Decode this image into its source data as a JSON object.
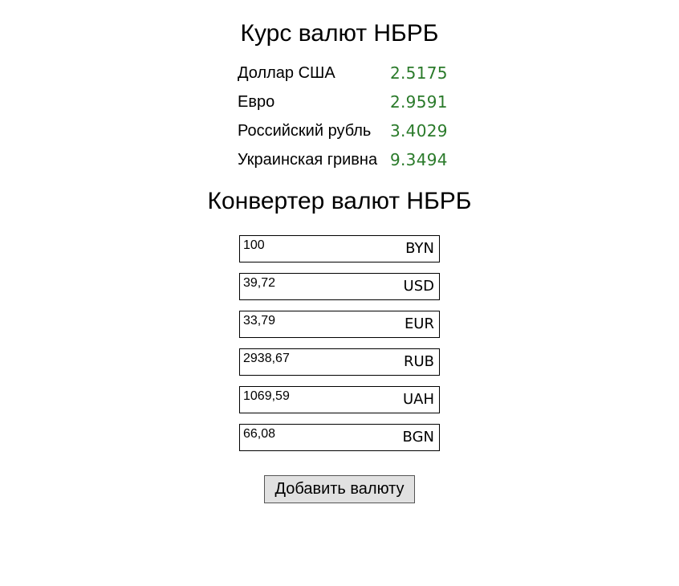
{
  "rates_title": "Курс валют НБРБ",
  "rates": [
    {
      "name": "Доллар США",
      "value": "2.5175"
    },
    {
      "name": "Евро",
      "value": "2.9591"
    },
    {
      "name": "Российский рубль",
      "value": "3.4029"
    },
    {
      "name": "Украинская гривна",
      "value": "9.3494"
    }
  ],
  "converter_title": "Конвертер валют НБРБ",
  "converter": [
    {
      "value": "100",
      "code": "BYN"
    },
    {
      "value": "39,72",
      "code": "USD"
    },
    {
      "value": "33,79",
      "code": "EUR"
    },
    {
      "value": "2938,67",
      "code": "RUB"
    },
    {
      "value": "1069,59",
      "code": "UAH"
    },
    {
      "value": "66,08",
      "code": "BGN"
    }
  ],
  "add_button_label": "Добавить валюту",
  "colors": {
    "rate_value": "#2a7a2a",
    "button_bg": "#e1e1e1"
  }
}
